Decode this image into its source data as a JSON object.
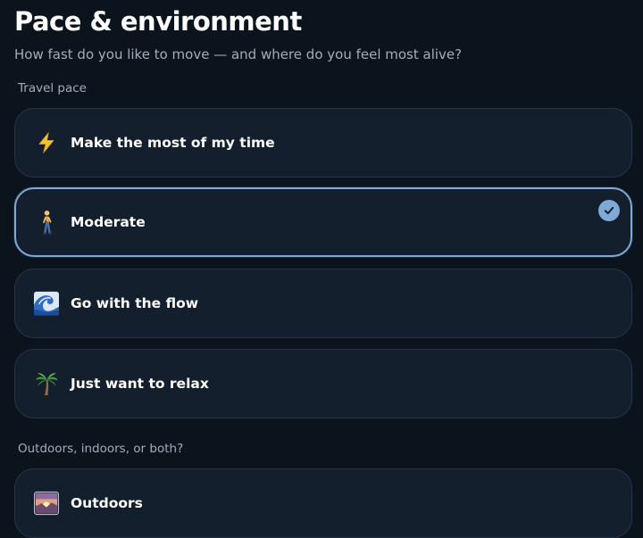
{
  "header": {
    "title": "Pace & environment",
    "subtitle": "How fast do you like to move — and where do you feel most alive?"
  },
  "travel_pace": {
    "label": "Travel pace",
    "selected": "Moderate",
    "options": [
      {
        "label": "Make the most of my time",
        "icon": "lightning-bolt-icon",
        "selected": false
      },
      {
        "label": "Moderate",
        "icon": "walking-person-icon",
        "selected": true
      },
      {
        "label": "Go with the flow",
        "icon": "wave-icon",
        "selected": false
      },
      {
        "label": "Just want to relax",
        "icon": "palm-tree-icon",
        "selected": false
      }
    ]
  },
  "environment": {
    "label": "Outdoors, indoors, or both?",
    "options": [
      {
        "label": "Outdoors",
        "icon": "sunrise-icon",
        "selected": false
      }
    ]
  },
  "colors": {
    "background": "#0b131d",
    "card": "#141f2d",
    "card_border": "#273445",
    "accent": "#7fa9d6",
    "muted_text": "#a3adba"
  }
}
